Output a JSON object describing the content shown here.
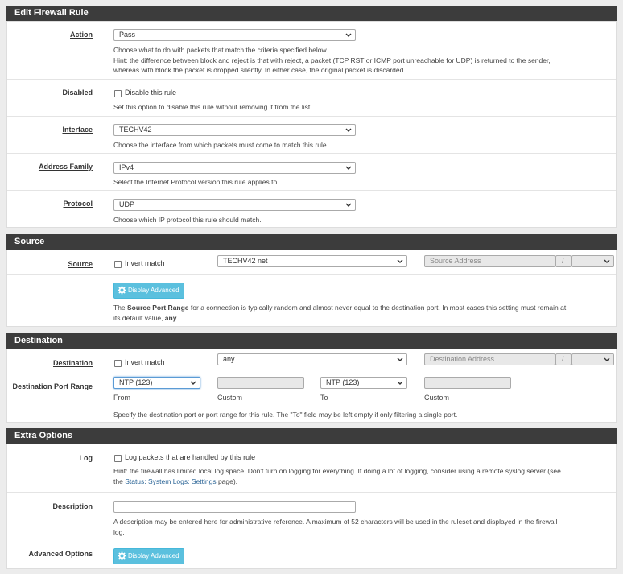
{
  "edit": {
    "title": "Edit Firewall Rule",
    "action": {
      "label": "Action",
      "value": "Pass",
      "help1": "Choose what to do with packets that match the criteria specified below.",
      "help2": "Hint: the difference between block and reject is that with reject, a packet (TCP RST or ICMP port unreachable for UDP) is returned to the sender,",
      "help3": "whereas with block the packet is dropped silently. In either case, the original packet is discarded."
    },
    "disabled": {
      "label": "Disabled",
      "checkbox_label": "Disable this rule",
      "help": "Set this option to disable this rule without removing it from the list."
    },
    "interface": {
      "label": "Interface",
      "value": "TECHV42",
      "help": "Choose the interface from which packets must come to match this rule."
    },
    "address_family": {
      "label": "Address Family",
      "value": "IPv4",
      "help": "Select the Internet Protocol version this rule applies to."
    },
    "protocol": {
      "label": "Protocol",
      "value": "UDP",
      "help": "Choose which IP protocol this rule should match."
    }
  },
  "source": {
    "title": "Source",
    "label": "Source",
    "invert_label": "Invert match",
    "type_value": "TECHV42 net",
    "address_placeholder": "Source Address",
    "slash": "/",
    "advanced_button": "Display Advanced",
    "help_pre": "The ",
    "help_bold": "Source Port Range",
    "help_mid": " for a connection is typically random and almost never equal to the destination port. In most cases this setting must remain at",
    "help_line2_pre": "its default value, ",
    "help_line2_bold": "any",
    "help_line2_post": "."
  },
  "destination": {
    "title": "Destination",
    "label": "Destination",
    "invert_label": "Invert match",
    "type_value": "any",
    "address_placeholder": "Destination Address",
    "slash": "/",
    "port_range_label": "Destination Port Range",
    "from_value": "NTP (123)",
    "to_value": "NTP (123)",
    "from_caption": "From",
    "custom_caption": "Custom",
    "to_caption": "To",
    "custom_caption2": "Custom",
    "help": "Specify the destination port or port range for this rule. The \"To\" field may be left empty if only filtering a single port."
  },
  "extra": {
    "title": "Extra Options",
    "log": {
      "label": "Log",
      "checkbox_label": "Log packets that are handled by this rule",
      "help1": "Hint: the firewall has limited local log space. Don't turn on logging for everything. If doing a lot of logging, consider using a remote syslog server (see",
      "help2_pre": "the ",
      "help2_link": "Status: System Logs: Settings",
      "help2_post": " page)."
    },
    "description": {
      "label": "Description",
      "value": "",
      "help1": "A description may be entered here for administrative reference. A maximum of 52 characters will be used in the ruleset and displayed in the firewall",
      "help2": "log."
    },
    "advanced": {
      "label": "Advanced Options",
      "button": "Display Advanced"
    }
  },
  "colors": {
    "header_bg": "#3c3c3c",
    "button_bg": "#5bc0de",
    "link": "#2a6496"
  },
  "icons": [
    "chevron-down-icon",
    "gear-icon",
    "checkbox"
  ]
}
